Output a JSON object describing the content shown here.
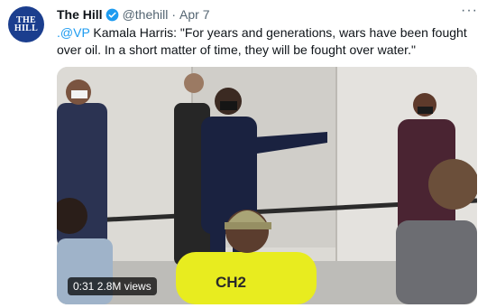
{
  "tweet": {
    "avatar_text_line1": "THE",
    "avatar_text_line2": "HILL",
    "author_name": "The Hill",
    "handle": "@thehill",
    "separator": "·",
    "date": "Apr 7",
    "more_icon": "···",
    "text_mention": ".@VP",
    "text_body": " Kamala Harris: \"For years and generations, wars have been fought over oil. In a short matter of time, they will be fought over water.\""
  },
  "media": {
    "timestamp": "0:31",
    "views": "2.8M views",
    "shirt_text": "CH2"
  },
  "colors": {
    "accent": "#1d9bf0",
    "avatar": "#1b3e8e",
    "shirt": "#e8ec1f"
  }
}
